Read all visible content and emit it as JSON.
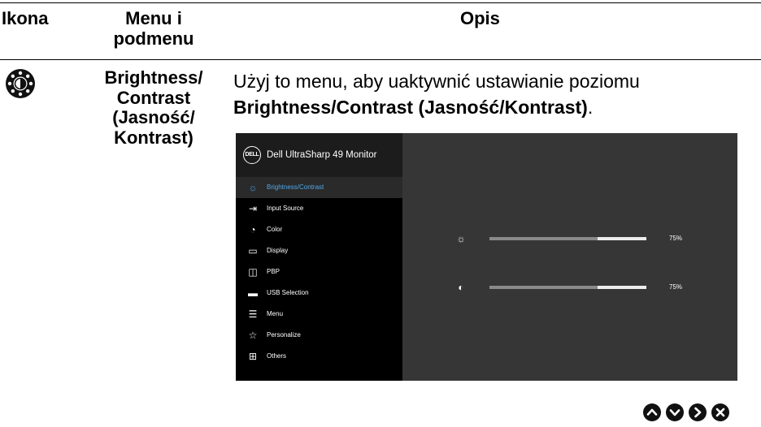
{
  "table": {
    "headers": {
      "icon": "Ikona",
      "menu_line1": "Menu i",
      "menu_line2": "podmenu",
      "desc": "Opis"
    },
    "row": {
      "icon_name": "brightness-contrast-icon",
      "menu_lines": [
        "Brightness/",
        "Contrast",
        "(Jasność/",
        "Kontrast)"
      ],
      "desc_line1": "Użyj to menu, aby uaktywnić ustawianie poziomu",
      "desc_line2_bold": "Brightness/Contrast (Jasność/Kontrast)",
      "desc_line2_end": "."
    }
  },
  "osd": {
    "logo": "DELL",
    "title": "Dell UltraSharp 49 Monitor",
    "menu": [
      {
        "label": "Brightness/Contrast",
        "icon": "sun-icon",
        "selected": true
      },
      {
        "label": "Input Source",
        "icon": "input-source-icon"
      },
      {
        "label": "Color",
        "icon": "color-icon"
      },
      {
        "label": "Display",
        "icon": "display-icon"
      },
      {
        "label": "PBP",
        "icon": "pbp-icon"
      },
      {
        "label": "USB Selection",
        "icon": "usb-icon"
      },
      {
        "label": "Menu",
        "icon": "menu-icon"
      },
      {
        "label": "Personalize",
        "icon": "star-icon"
      },
      {
        "label": "Others",
        "icon": "others-icon"
      }
    ],
    "brightness": {
      "value": 75,
      "label": "75%"
    },
    "contrast": {
      "value": 75,
      "label": "75%"
    },
    "selected_color": "#4fa8e8"
  },
  "nav_buttons": [
    "up-icon",
    "down-icon",
    "right-icon",
    "close-icon"
  ]
}
